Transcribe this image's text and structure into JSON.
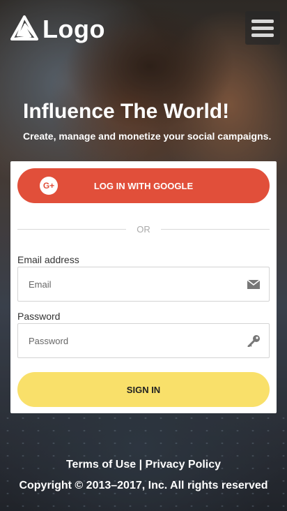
{
  "header": {
    "logo_text": "Logo",
    "logo_icon": "triangle-logo-icon",
    "menu_icon": "hamburger-menu-icon"
  },
  "hero": {
    "title": "Influence The World!",
    "subtitle": "Create, manage and monetize your social campaigns."
  },
  "login": {
    "google_label": "LOG IN WITH GOOGLE",
    "google_icon": "google-plus-icon",
    "google_glyph": "G+",
    "or_text": "OR",
    "email_label": "Email address",
    "email_placeholder": "Email",
    "email_value": "",
    "email_icon": "envelope-icon",
    "password_label": "Password",
    "password_placeholder": "Password",
    "password_value": "",
    "password_icon": "key-icon",
    "signin_label": "SIGN IN"
  },
  "footer": {
    "terms": "Terms of Use",
    "separator": "|",
    "privacy": "Privacy Policy",
    "copyright": "Copyright © 2013–2017, Inc. All rights reserved"
  },
  "colors": {
    "google_red": "#e14f3a",
    "signin_yellow": "#f9e06a"
  }
}
